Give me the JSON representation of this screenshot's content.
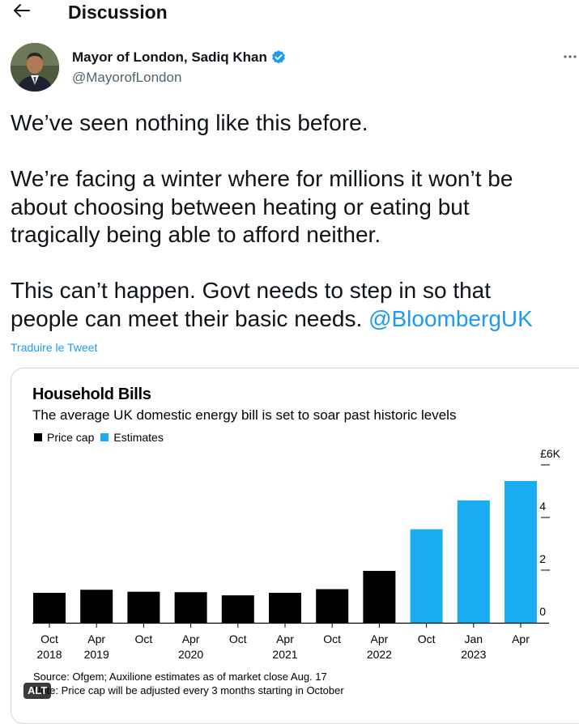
{
  "header": {
    "title": "Discussion"
  },
  "author": {
    "name": "Mayor of London, Sadiq Khan",
    "handle": "@MayorofLondon"
  },
  "tweet": {
    "line1": "We’ve seen nothing like this before.",
    "line2": "We’re facing a winter where for millions it won’t be",
    "line3": "about choosing between heating or eating but",
    "line4": "tragically being able to afford neither.",
    "line5": "This can’t happen. Govt needs to step in so that",
    "line6_text": "people can meet their basic needs. ",
    "line6_mention": "@BloombergUK",
    "translate": "Traduire le Tweet"
  },
  "media": {
    "alt_badge": "ALT",
    "source": "Source: Ofgem; Auxilione estimates as of market close Aug. 17",
    "note": "Note: Price cap will be adjusted every 3 months starting in October"
  },
  "colors": {
    "price_cap": "#000000",
    "estimates": "#1aabf0",
    "link": "#1d9bf0",
    "verified": "#1d9bf0"
  },
  "chart_data": {
    "type": "bar",
    "title": "Household Bills",
    "subtitle": "The average UK domestic energy bill is set to soar past historic levels",
    "legend": [
      "Price cap",
      "Estimates"
    ],
    "categories": [
      "Oct 2018",
      "Apr 2019",
      "Oct",
      "Apr 2020",
      "Oct",
      "Apr 2021",
      "Oct",
      "Apr 2022",
      "Oct",
      "Jan 2023",
      "Apr"
    ],
    "tick_labels_top": [
      "Oct",
      "Apr",
      "Oct",
      "Apr",
      "Oct",
      "Apr",
      "Oct",
      "Apr",
      "Oct",
      "Jan",
      "Apr"
    ],
    "tick_labels_bottom": [
      "2018",
      "2019",
      "",
      "2020",
      "",
      "2021",
      "",
      "2022",
      "",
      "2023",
      ""
    ],
    "series": [
      {
        "name": "Price cap",
        "values": [
          1137,
          1254,
          1179,
          1162,
          1042,
          1138,
          1277,
          1971,
          null,
          null,
          null
        ]
      },
      {
        "name": "Estimates",
        "values": [
          null,
          null,
          null,
          null,
          null,
          null,
          null,
          null,
          3554,
          4650,
          5386
        ]
      }
    ],
    "ylim": [
      0,
      6000
    ],
    "yticks": [
      {
        "value": 0,
        "label": "0"
      },
      {
        "value": 2000,
        "label": "2"
      },
      {
        "value": 4000,
        "label": "4"
      },
      {
        "value": 6000,
        "label": "£6K"
      }
    ],
    "grid": false
  }
}
